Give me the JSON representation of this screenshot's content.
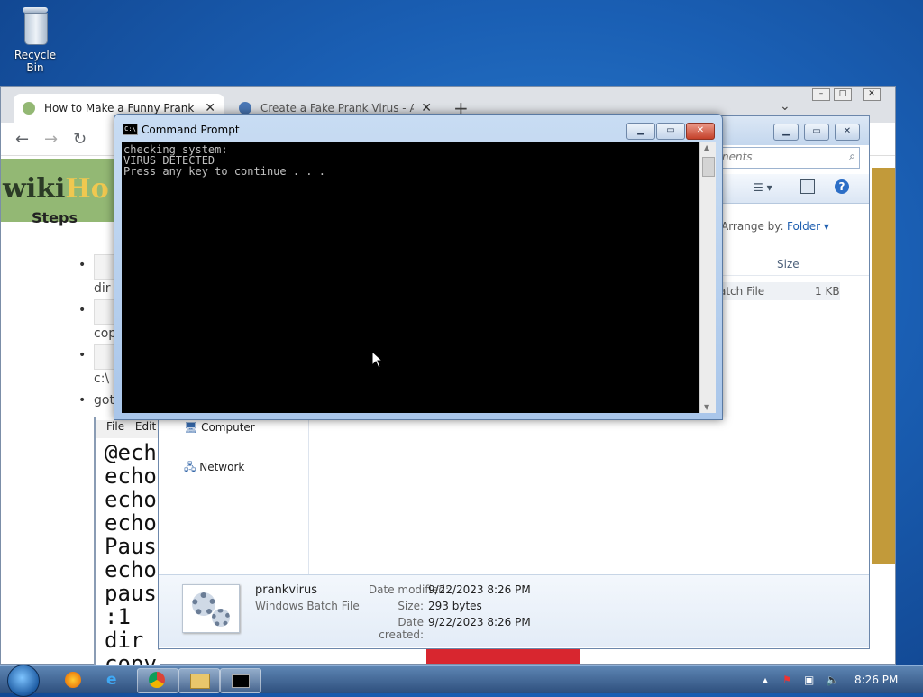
{
  "desktop": {
    "recycle_bin_label": "Recycle Bin"
  },
  "browser": {
    "tabs": [
      {
        "title": "How to Make a Funny Prank Viru",
        "favicon_color": "#93b874"
      },
      {
        "title": "Create a Fake Prank Virus - Awe",
        "favicon_color": "#4a77b5"
      }
    ],
    "new_tab": "+",
    "page": {
      "logo_prefix": "wiki",
      "logo_suffix": "Ho",
      "steps_heading": "Steps",
      "bullets": [
        "dir",
        "cop",
        "c:\\",
        "got"
      ]
    }
  },
  "explorer": {
    "search_placeholder": "nents",
    "arrange_label": "Arrange by:",
    "arrange_value": "Folder",
    "column_size": "Size",
    "file_type_partial": "atch File",
    "file_size": "1 KB",
    "nav_items": [
      "Computer",
      "Network"
    ],
    "details": {
      "name": "prankvirus",
      "type": "Windows Batch File",
      "modified_label": "Date modified:",
      "modified_value": "9/22/2023 8:26 PM",
      "size_label": "Size:",
      "size_value": "293 bytes",
      "created_label": "Date created:",
      "created_value": "9/22/2023 8:26 PM"
    }
  },
  "notepad": {
    "menu": [
      "File",
      "Edit"
    ],
    "lines": [
      "@ech",
      "echo",
      "echo",
      "echo",
      "Paus",
      "echo",
      "paus",
      ":1",
      "dir /s",
      "copy c:\\tmp.bat"
    ]
  },
  "cmd": {
    "title": "Command Prompt",
    "icon_text": "C:\\",
    "lines": [
      "checking system:",
      "VIRUS DETECTED",
      "Press any key to continue . . ."
    ]
  },
  "taskbar": {
    "time": "8:26 PM"
  }
}
